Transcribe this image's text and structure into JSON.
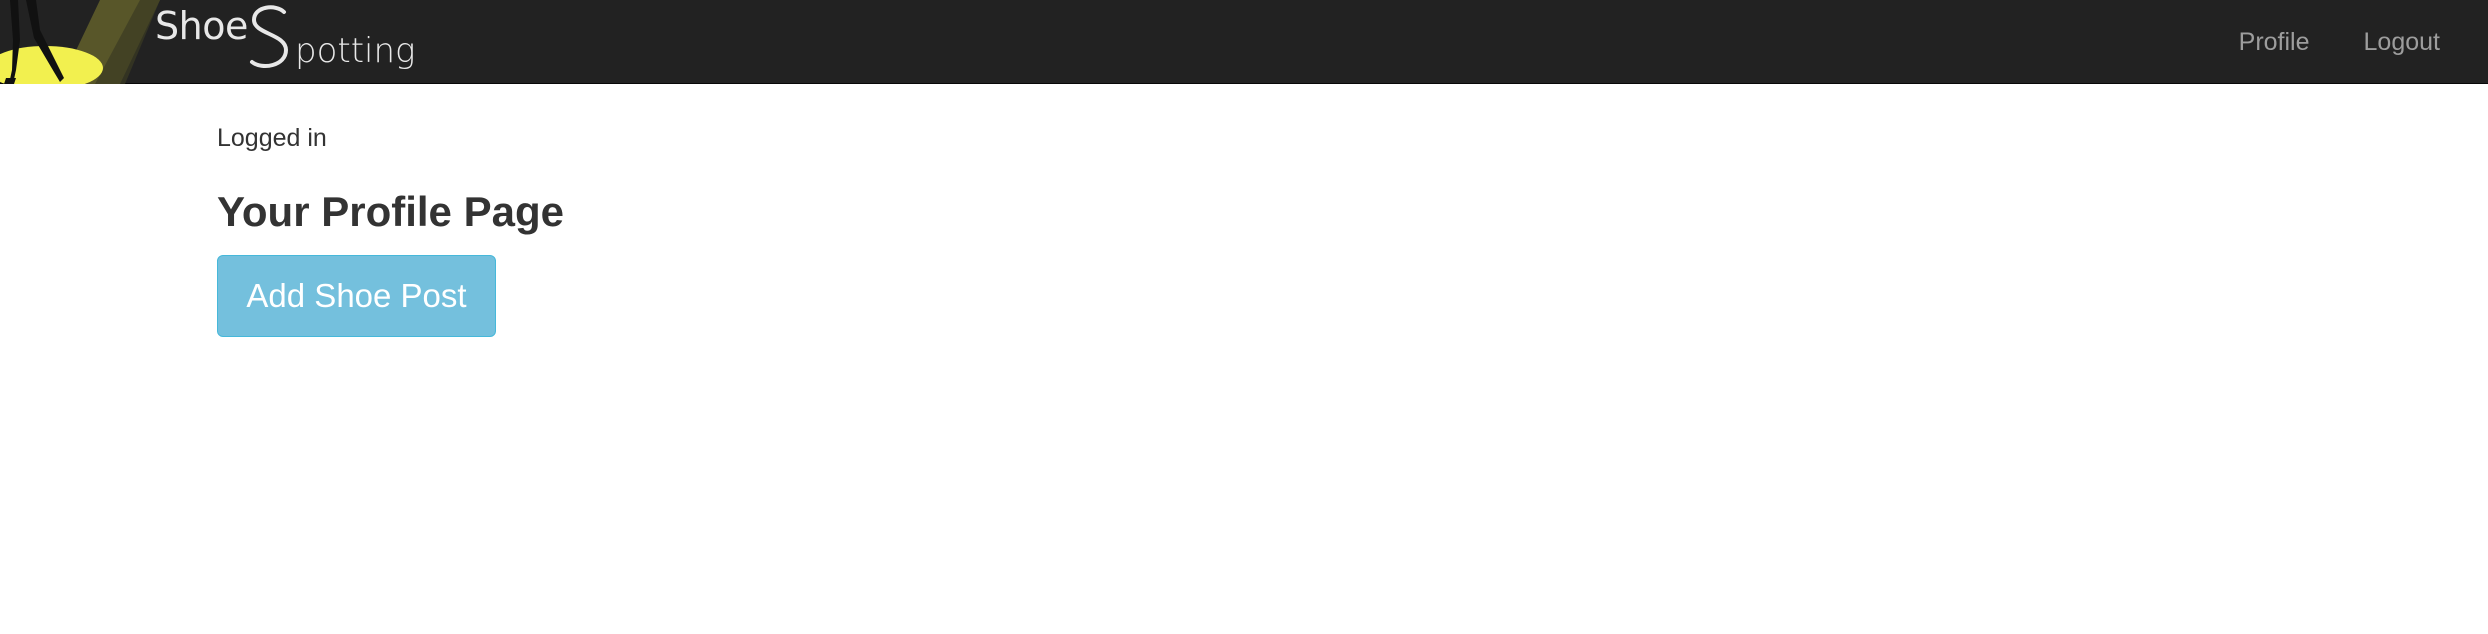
{
  "navbar": {
    "brand_part1": "Shoe",
    "brand_part2": "potting",
    "links": {
      "profile": "Profile",
      "logout": "Logout"
    }
  },
  "main": {
    "status_text": "Logged in",
    "page_title": "Your Profile Page",
    "add_button_label": "Add Shoe Post"
  },
  "colors": {
    "navbar_bg": "#222222",
    "spotlight_yellow": "#f2f04f",
    "button_bg": "#74c0dd",
    "nav_link": "#9d9d9d"
  },
  "icons": {
    "logo": "spotlight-legs-logo",
    "brand_s": "stylized-s-glyph"
  }
}
